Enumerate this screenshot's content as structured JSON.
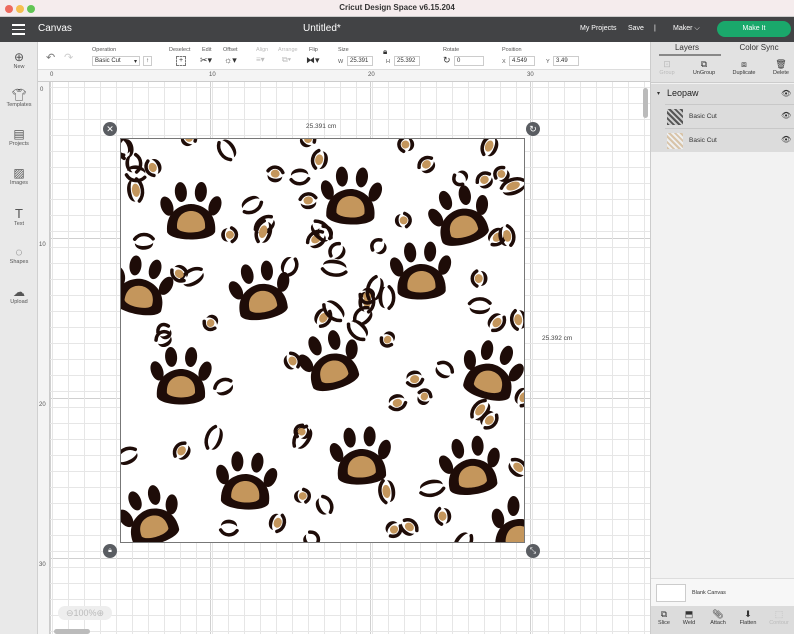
{
  "window": {
    "title": "Cricut Design Space  v6.15.204"
  },
  "header": {
    "section": "Canvas",
    "doc_title": "Untitled*",
    "my_projects": "My Projects",
    "save": "Save",
    "separator": "|",
    "machine": "Maker",
    "make_it": "Make It",
    "make_it_color": "#1aa86b"
  },
  "toolbar": {
    "operation_label": "Operation",
    "operation_value": "Basic Cut",
    "deselect": "Deselect",
    "edit": "Edit",
    "offset": "Offset",
    "align": "Align",
    "arrange": "Arrange",
    "flip": "Flip",
    "size_label": "Size",
    "w_label": "W",
    "w_value": "25.391",
    "h_label": "H",
    "h_value": "25.392",
    "rotate_label": "Rotate",
    "rotate_value": "0",
    "position_label": "Position",
    "x_label": "X",
    "x_value": "4.549",
    "y_label": "Y",
    "y_value": "3.49"
  },
  "sidebar": {
    "items": [
      {
        "label": "New"
      },
      {
        "label": "Templates"
      },
      {
        "label": "Projects"
      },
      {
        "label": "Images"
      },
      {
        "label": "Text"
      },
      {
        "label": "Shapes"
      },
      {
        "label": "Upload"
      }
    ]
  },
  "rulers": {
    "top": [
      "0",
      "10",
      "20",
      "30"
    ],
    "left": [
      "0",
      "10",
      "20",
      "30"
    ]
  },
  "canvas": {
    "width_dim": "25.391 cm",
    "height_dim": "25.392 cm",
    "zoom": "100%",
    "pattern_colors": {
      "dark": "#1e0c08",
      "tan": "#c4965c"
    }
  },
  "panel": {
    "tabs": [
      "Layers",
      "Color Sync"
    ],
    "actions": [
      "Group",
      "UnGroup",
      "Duplicate",
      "Delete"
    ],
    "group_name": "Leopaw",
    "layers": [
      {
        "name": "Basic Cut"
      },
      {
        "name": "Basic Cut"
      }
    ],
    "blank_canvas": "Blank Canvas",
    "bottom_actions": [
      "Slice",
      "Weld",
      "Attach",
      "Flatten",
      "Contour"
    ]
  }
}
